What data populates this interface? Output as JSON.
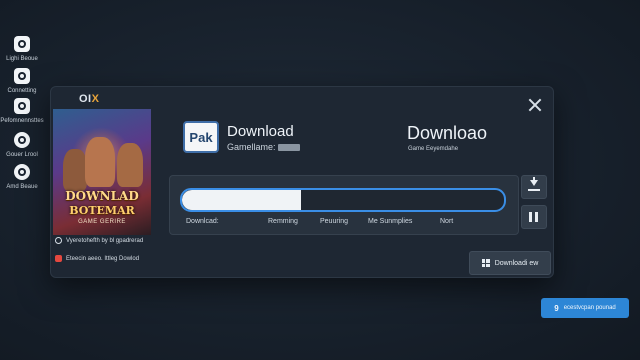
{
  "sidebar": {
    "items": [
      {
        "label": "Lighi Beoue",
        "icon": "camera-icon"
      },
      {
        "label": "Connetting",
        "icon": "image-icon"
      },
      {
        "label": "Pefomnennsttes",
        "icon": "monitor-icon"
      },
      {
        "label": "Gouer Lrool",
        "icon": "disc-icon"
      },
      {
        "label": "Amd Beaue",
        "icon": "disc-icon"
      }
    ]
  },
  "dialog": {
    "brand": {
      "left": "OI",
      "accent": "X"
    },
    "cover": {
      "line1": "DOWNLAD",
      "line2": "BOTEMAR",
      "line3": "GAME GERIRE"
    },
    "verify_text": "Vyeretohefth by bl gpadrerad",
    "warning_text": "Eteecin aeeo. Ittleg Dowlod",
    "pak_badge": "Pak",
    "title": "Download",
    "subtitle": "Gamellame:",
    "title_right": "Downloao",
    "subtitle_right": "Game Eeyemdahe",
    "progress": {
      "value": 0.37,
      "stats": [
        "Downlcad:",
        "Remming",
        "Peuuring",
        "Me Sunmplies",
        "Nort"
      ]
    },
    "download_button_label": "Downloadi ew"
  },
  "toast": {
    "icon": "9",
    "label": "ecestvcpan pounad"
  },
  "colors": {
    "accent": "#3a8ee6",
    "toast": "#2d86d6",
    "warning": "#e5483f"
  }
}
